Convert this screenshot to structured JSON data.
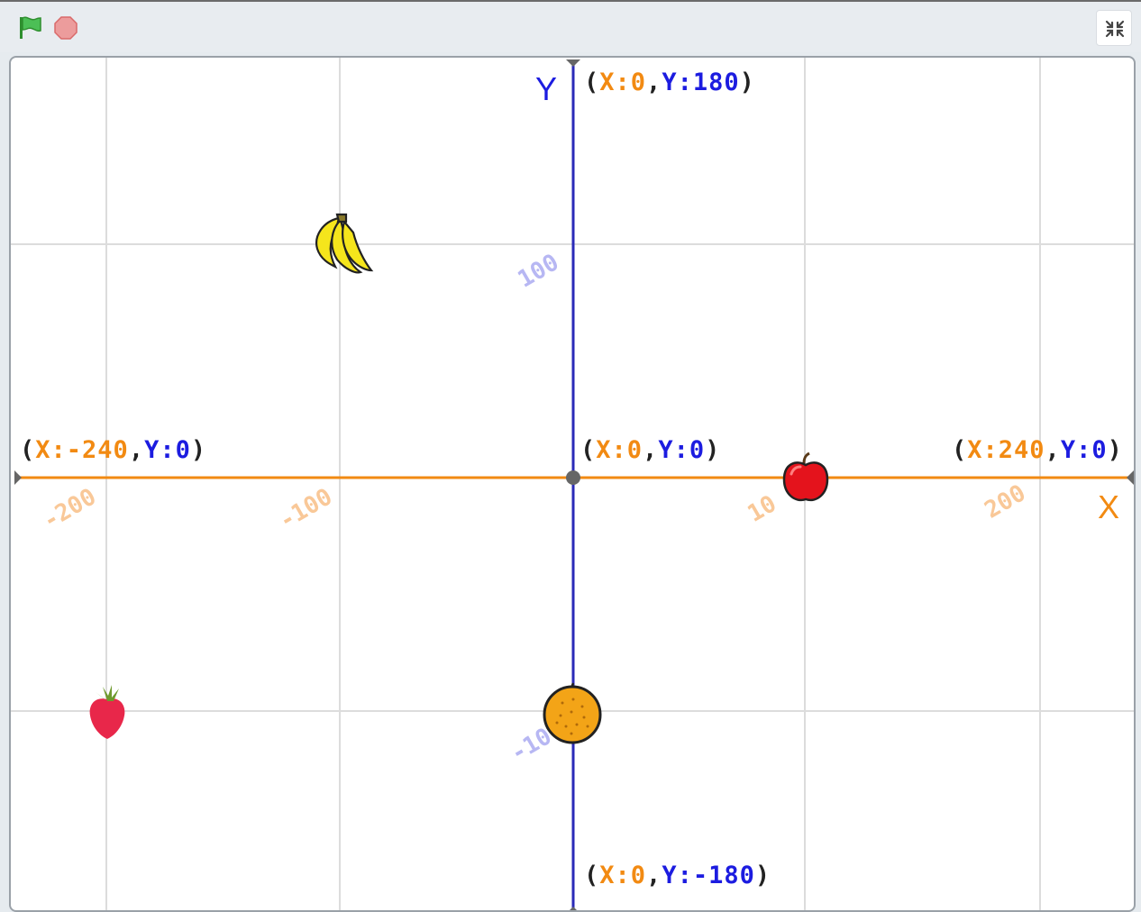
{
  "toolbar": {
    "green_flag_icon": "green-flag-icon",
    "stop_icon": "stop-sign-icon",
    "unfullscreen_icon": "exit-fullscreen-icon"
  },
  "colors": {
    "x_axis": "#f28a12",
    "y_axis": "#2a2ab8",
    "grid": "#dcdcdc",
    "x_text": "#f28a12",
    "y_text": "#1c1ce0"
  },
  "axes": {
    "x_letter": "X",
    "y_letter": "Y",
    "x_ticks": [
      "-200",
      "-100",
      "10",
      "200"
    ],
    "y_ticks": [
      "100",
      "-10"
    ]
  },
  "coordinate_labels": {
    "top": {
      "x_part": "X:0",
      "y_part": "Y:180"
    },
    "bottom": {
      "x_part": "X:0",
      "y_part": "Y:-180"
    },
    "left": {
      "x_part": "X:-240",
      "y_part": "Y:0"
    },
    "right": {
      "x_part": "X:240",
      "y_part": "Y:0"
    },
    "origin": {
      "x_part": "X:0",
      "y_part": "Y:0"
    }
  },
  "sprites": [
    {
      "name": "banana",
      "icon": "banana-icon",
      "x": -100,
      "y": 100
    },
    {
      "name": "apple",
      "icon": "apple-icon",
      "x": 100,
      "y": 0
    },
    {
      "name": "strawberry",
      "icon": "strawberry-icon",
      "x": -200,
      "y": -100
    },
    {
      "name": "orange",
      "icon": "orange-icon",
      "x": 0,
      "y": -100
    }
  ]
}
